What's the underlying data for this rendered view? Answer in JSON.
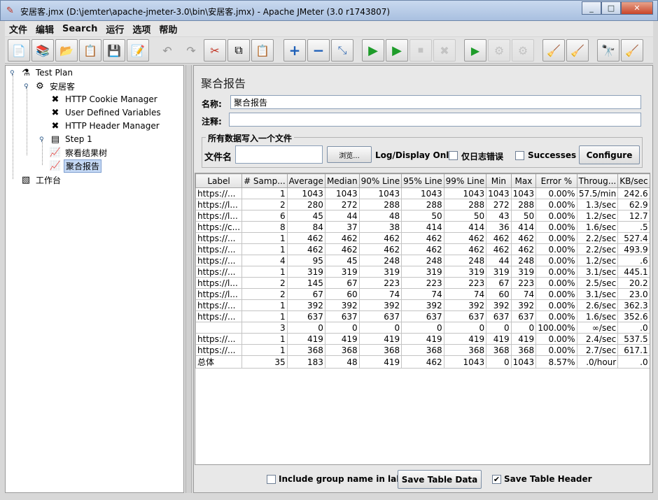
{
  "window": {
    "title": "安居客.jmx (D:\\jemter\\apache-jmeter-3.0\\bin\\安居客.jmx) - Apache JMeter (3.0 r1743807)",
    "minimize": "_",
    "maximize": "□",
    "close": "✕"
  },
  "menu": [
    "文件",
    "编辑",
    "Search",
    "运行",
    "选项",
    "帮助"
  ],
  "toolbar": [
    {
      "icon": "new-icon",
      "glyph": "📄"
    },
    {
      "icon": "templates-icon",
      "glyph": "📚"
    },
    {
      "icon": "open-icon",
      "glyph": "📂"
    },
    {
      "icon": "close-file-icon",
      "glyph": "📋"
    },
    {
      "icon": "save-icon",
      "glyph": "💾"
    },
    {
      "icon": "save-as-icon",
      "glyph": "📝"
    },
    {
      "icon": "undo-icon",
      "glyph": "↶"
    },
    {
      "icon": "redo-icon",
      "glyph": "↷"
    },
    {
      "icon": "cut-icon",
      "glyph": "✂"
    },
    {
      "icon": "copy-icon",
      "glyph": "⧉"
    },
    {
      "icon": "paste-icon",
      "glyph": "📋"
    },
    {
      "icon": "expand-icon",
      "glyph": "+"
    },
    {
      "icon": "collapse-icon",
      "glyph": "−"
    },
    {
      "icon": "toggle-icon",
      "glyph": "⤡"
    },
    {
      "icon": "start-icon",
      "glyph": "▶"
    },
    {
      "icon": "start-no-pauses-icon",
      "glyph": "▶"
    },
    {
      "icon": "stop-icon",
      "glyph": "⏹"
    },
    {
      "icon": "shutdown-icon",
      "glyph": "✖"
    },
    {
      "icon": "remote-start-icon",
      "glyph": "▶"
    },
    {
      "icon": "remote-stop-icon",
      "glyph": "⚙"
    },
    {
      "icon": "remote-shutdown-icon",
      "glyph": "⚙"
    },
    {
      "icon": "clear-icon",
      "glyph": "🧹"
    },
    {
      "icon": "clear-all-icon",
      "glyph": "🧹"
    },
    {
      "icon": "search-icon",
      "glyph": "🔭"
    },
    {
      "icon": "reset-search-icon",
      "glyph": "🧹"
    }
  ],
  "tree": {
    "test_plan": "Test Plan",
    "thread_group": "安居客",
    "cookie_manager": "HTTP Cookie Manager",
    "user_vars": "User Defined Variables",
    "header_manager": "HTTP Header Manager",
    "step": "Step 1",
    "results_tree": "察看结果树",
    "aggregate": "聚合报告",
    "workbench": "工作台"
  },
  "panel": {
    "title": "聚合报告",
    "name_label": "名称:",
    "name_value": "聚合报告",
    "comment_label": "注释:",
    "comment_value": "",
    "group_title": "所有数据写入一个文件",
    "filename_label": "文件名",
    "filename_value": "",
    "browse_label": "浏览...",
    "log_display_label": "Log/Display Only:",
    "errors_label": "仅日志错误",
    "successes_label": "Successes",
    "configure_label": "Configure"
  },
  "table": {
    "headers": [
      "Label",
      "# Samp...",
      "Average",
      "Median",
      "90% Line",
      "95% Line",
      "99% Line",
      "Min",
      "Max",
      "Error %",
      "Throug...",
      "KB/sec"
    ],
    "rows": [
      [
        "https://...",
        "1",
        "1043",
        "1043",
        "1043",
        "1043",
        "1043",
        "1043",
        "1043",
        "0.00%",
        "57.5/min",
        "242.6"
      ],
      [
        "https://l...",
        "2",
        "280",
        "272",
        "288",
        "288",
        "288",
        "272",
        "288",
        "0.00%",
        "1.3/sec",
        "62.9"
      ],
      [
        "https://l...",
        "6",
        "45",
        "44",
        "48",
        "50",
        "50",
        "43",
        "50",
        "0.00%",
        "1.2/sec",
        "12.7"
      ],
      [
        "https://c...",
        "8",
        "84",
        "37",
        "38",
        "414",
        "414",
        "36",
        "414",
        "0.00%",
        "1.6/sec",
        ".5"
      ],
      [
        "https://...",
        "1",
        "462",
        "462",
        "462",
        "462",
        "462",
        "462",
        "462",
        "0.00%",
        "2.2/sec",
        "527.4"
      ],
      [
        "https://...",
        "1",
        "462",
        "462",
        "462",
        "462",
        "462",
        "462",
        "462",
        "0.00%",
        "2.2/sec",
        "493.9"
      ],
      [
        "https://...",
        "4",
        "95",
        "45",
        "248",
        "248",
        "248",
        "44",
        "248",
        "0.00%",
        "1.2/sec",
        ".6"
      ],
      [
        "https://...",
        "1",
        "319",
        "319",
        "319",
        "319",
        "319",
        "319",
        "319",
        "0.00%",
        "3.1/sec",
        "445.1"
      ],
      [
        "https://l...",
        "2",
        "145",
        "67",
        "223",
        "223",
        "223",
        "67",
        "223",
        "0.00%",
        "2.5/sec",
        "20.2"
      ],
      [
        "https://l...",
        "2",
        "67",
        "60",
        "74",
        "74",
        "74",
        "60",
        "74",
        "0.00%",
        "3.1/sec",
        "23.0"
      ],
      [
        "https://...",
        "1",
        "392",
        "392",
        "392",
        "392",
        "392",
        "392",
        "392",
        "0.00%",
        "2.6/sec",
        "362.3"
      ],
      [
        "https://...",
        "1",
        "637",
        "637",
        "637",
        "637",
        "637",
        "637",
        "637",
        "0.00%",
        "1.6/sec",
        "352.6"
      ],
      [
        "",
        "3",
        "0",
        "0",
        "0",
        "0",
        "0",
        "0",
        "0",
        "100.00%",
        "∞/sec",
        ".0"
      ],
      [
        "https://...",
        "1",
        "419",
        "419",
        "419",
        "419",
        "419",
        "419",
        "419",
        "0.00%",
        "2.4/sec",
        "537.5"
      ],
      [
        "https://...",
        "1",
        "368",
        "368",
        "368",
        "368",
        "368",
        "368",
        "368",
        "0.00%",
        "2.7/sec",
        "617.1"
      ],
      [
        "总体",
        "35",
        "183",
        "48",
        "419",
        "462",
        "1043",
        "0",
        "1043",
        "8.57%",
        ".0/hour",
        ".0"
      ]
    ]
  },
  "bottom": {
    "include_group_label": "Include group name in label?",
    "save_table_data": "Save Table Data",
    "save_table_header": "Save Table Header",
    "save_header_checked": "✔"
  }
}
